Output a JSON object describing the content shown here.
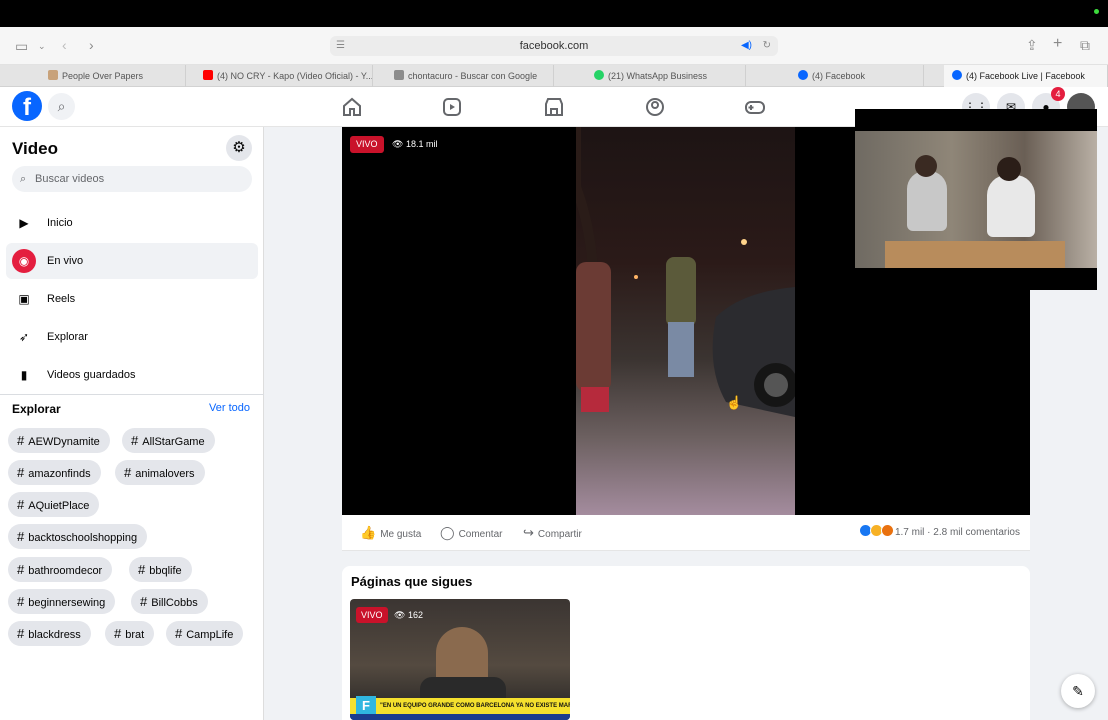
{
  "browser": {
    "url": "facebook.com",
    "tabs": [
      {
        "label": "People Over Papers",
        "favicon_color": "#c8a27a"
      },
      {
        "label": "(4) NO CRY - Kapo (Video Oficial) - Y...",
        "favicon_color": "#ff0000"
      },
      {
        "label": "chontacuro - Buscar con Google",
        "favicon_color": "#8c8c8c"
      },
      {
        "label": "(21) WhatsApp Business",
        "favicon_color": "#25d366"
      },
      {
        "label": "(4) Facebook",
        "favicon_color": "#0866ff"
      },
      {
        "label": "(4) Facebook Live | Facebook",
        "favicon_color": "#0866ff"
      }
    ]
  },
  "header": {
    "logo": "f",
    "notification_count": "4",
    "nav_icons": [
      "home-icon",
      "video-icon",
      "marketplace-icon",
      "groups-icon",
      "gaming-icon"
    ]
  },
  "sidebar": {
    "title": "Video",
    "search_placeholder": "Buscar videos",
    "items": [
      {
        "label": "Inicio",
        "icon": "play-icon"
      },
      {
        "label": "En vivo",
        "icon": "live-icon"
      },
      {
        "label": "Reels",
        "icon": "reels-icon"
      },
      {
        "label": "Explorar",
        "icon": "rocket-icon"
      },
      {
        "label": "Videos guardados",
        "icon": "bookmark-icon"
      }
    ],
    "explore_title": "Explorar",
    "see_all": "Ver todo",
    "hashtags": [
      "AEWDynamite",
      "AllStarGame",
      "amazonfinds",
      "animalovers",
      "AQuietPlace",
      "backtoschoolshopping",
      "bathroomdecor",
      "bbqlife",
      "beginnersewing",
      "BillCobbs",
      "blackdress",
      "brat",
      "CampLife"
    ]
  },
  "video": {
    "live_label": "VIVO",
    "views": "18.1 mil"
  },
  "actions": {
    "like": "Me gusta",
    "comment": "Comentar",
    "share": "Compartir",
    "reaction_count": "1.7 mil",
    "separator": "·",
    "comments_count": "2.8 mil comentarios"
  },
  "pages": {
    "title": "Páginas que sigues",
    "thumb_live": "VIVO",
    "thumb_views": "162",
    "thumb_ticker": "\"EN UN EQUIPO GRANDE COMO BARCELONA YA NO EXISTE MARGEN DE ERROR\"",
    "thumb_logo": "F"
  },
  "colors": {
    "brand": "#0866ff",
    "live": "#c9122a"
  }
}
